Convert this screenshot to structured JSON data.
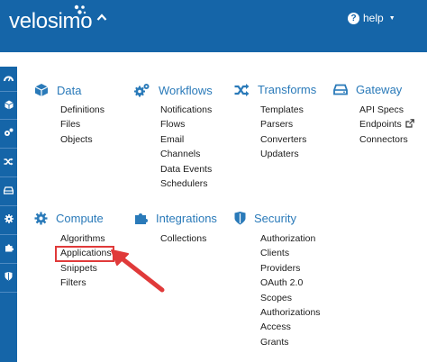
{
  "brand": {
    "name": "velosimo"
  },
  "header": {
    "help_label": "help"
  },
  "sections": [
    {
      "id": "data",
      "title": "Data",
      "icon": "database-icon",
      "links": [
        "Definitions",
        "Files",
        "Objects"
      ]
    },
    {
      "id": "workflows",
      "title": "Workflows",
      "icon": "cogs-icon",
      "links": [
        "Notifications",
        "Flows",
        "Email",
        "Channels",
        "Data Events",
        "Schedulers"
      ]
    },
    {
      "id": "transforms",
      "title": "Transforms",
      "icon": "shuffle-icon",
      "links": [
        "Templates",
        "Parsers",
        "Converters",
        "Updaters"
      ]
    },
    {
      "id": "gateway",
      "title": "Gateway",
      "icon": "hard-drive-icon",
      "links": [
        "API Specs",
        "Endpoints",
        "Connectors"
      ]
    },
    {
      "id": "compute",
      "title": "Compute",
      "icon": "gear-icon",
      "links": [
        "Algorithms",
        "Applications",
        "Snippets",
        "Filters"
      ]
    },
    {
      "id": "integrations",
      "title": "Integrations",
      "icon": "puzzle-icon",
      "links": [
        "Collections"
      ]
    },
    {
      "id": "security",
      "title": "Security",
      "icon": "shield-icon",
      "links": [
        "Authorization",
        "Clients",
        "Providers",
        "OAuth 2.0",
        "Scopes",
        "Authorizations",
        "Access",
        "Grants"
      ]
    }
  ],
  "sidebar": {
    "icons": [
      "dashboard-icon",
      "database-icon",
      "cogs-icon",
      "shuffle-icon",
      "hard-drive-icon",
      "gear-icon",
      "puzzle-icon",
      "shield-icon"
    ]
  },
  "annotation": {
    "highlighted_link": "Applications",
    "color": "#e03a3a"
  },
  "colors": {
    "brand_blue": "#1565a8",
    "section_blue": "#2a7ab9"
  }
}
